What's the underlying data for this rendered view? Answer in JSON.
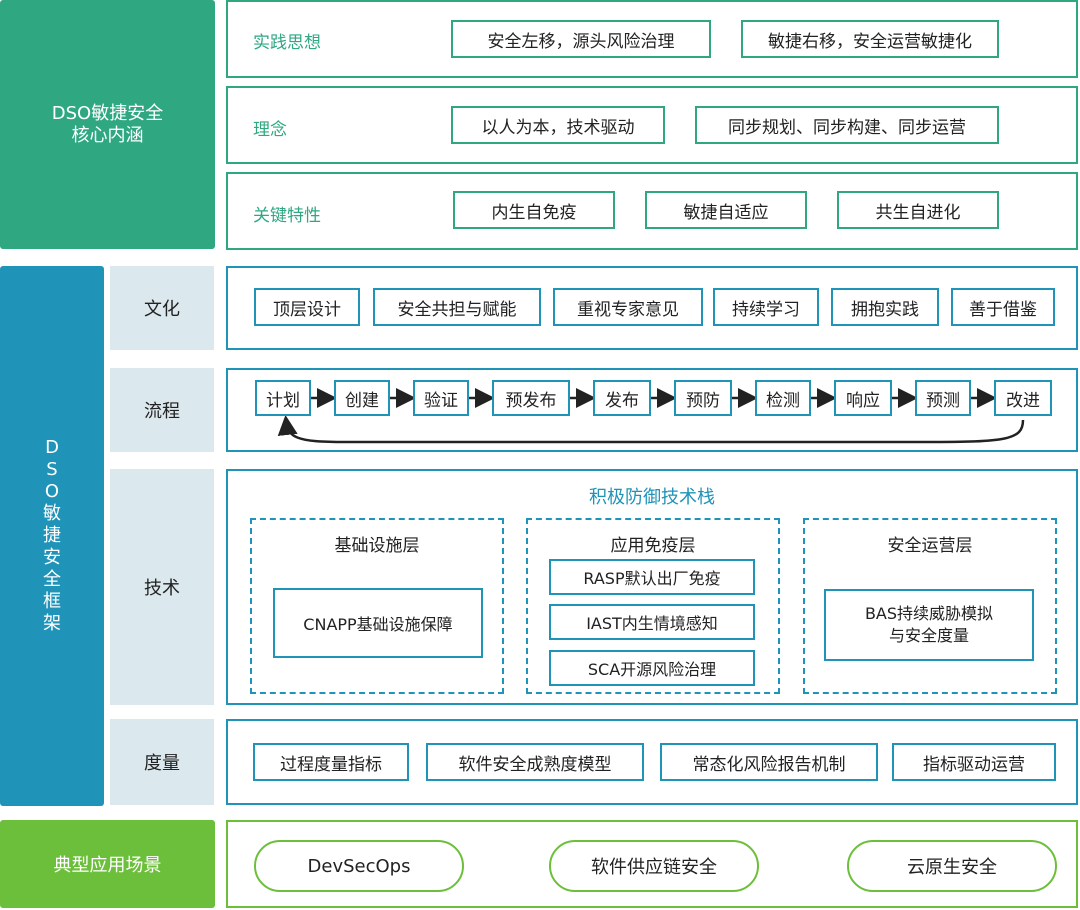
{
  "core": {
    "title_line1": "DSO敏捷安全",
    "title_line2": "核心内涵",
    "rows": [
      {
        "label": "实践思想",
        "items": [
          "安全左移，源头风险治理",
          "敏捷右移，安全运营敏捷化"
        ]
      },
      {
        "label": "理念",
        "items": [
          "以人为本，技术驱动",
          "同步规划、同步构建、同步运营"
        ]
      },
      {
        "label": "关键特性",
        "items": [
          "内生自免疫",
          "敏捷自适应",
          "共生自进化"
        ]
      }
    ]
  },
  "framework": {
    "title_chars": [
      "D",
      "S",
      "O",
      "敏",
      "捷",
      "安",
      "全",
      "框",
      "架"
    ],
    "culture": {
      "label": "文化",
      "items": [
        "顶层设计",
        "安全共担与赋能",
        "重视专家意见",
        "持续学习",
        "拥抱实践",
        "善于借鉴"
      ]
    },
    "process": {
      "label": "流程",
      "steps": [
        "计划",
        "创建",
        "验证",
        "预发布",
        "发布",
        "预防",
        "检测",
        "响应",
        "预测",
        "改进"
      ]
    },
    "tech": {
      "label": "技术",
      "stack_title": "积极防御技术栈",
      "layers": [
        {
          "title": "基础设施层",
          "items": [
            "CNAPP基础设施保障"
          ]
        },
        {
          "title": "应用免疫层",
          "items": [
            "RASP默认出厂免疫",
            "IAST内生情境感知",
            "SCA开源风险治理"
          ]
        },
        {
          "title": "安全运营层",
          "item_line1": "BAS持续威胁模拟",
          "item_line2": "与安全度量"
        }
      ]
    },
    "metrics": {
      "label": "度量",
      "items": [
        "过程度量指标",
        "软件安全成熟度模型",
        "常态化风险报告机制",
        "指标驱动运营"
      ]
    }
  },
  "scenarios": {
    "label": "典型应用场景",
    "items": [
      "DevSecOps",
      "软件供应链安全",
      "云原生安全"
    ]
  },
  "colors": {
    "teal": "#2fa882",
    "blue": "#1f93b8",
    "lime": "#6cbf3a",
    "gray": "#dbe8ee"
  }
}
